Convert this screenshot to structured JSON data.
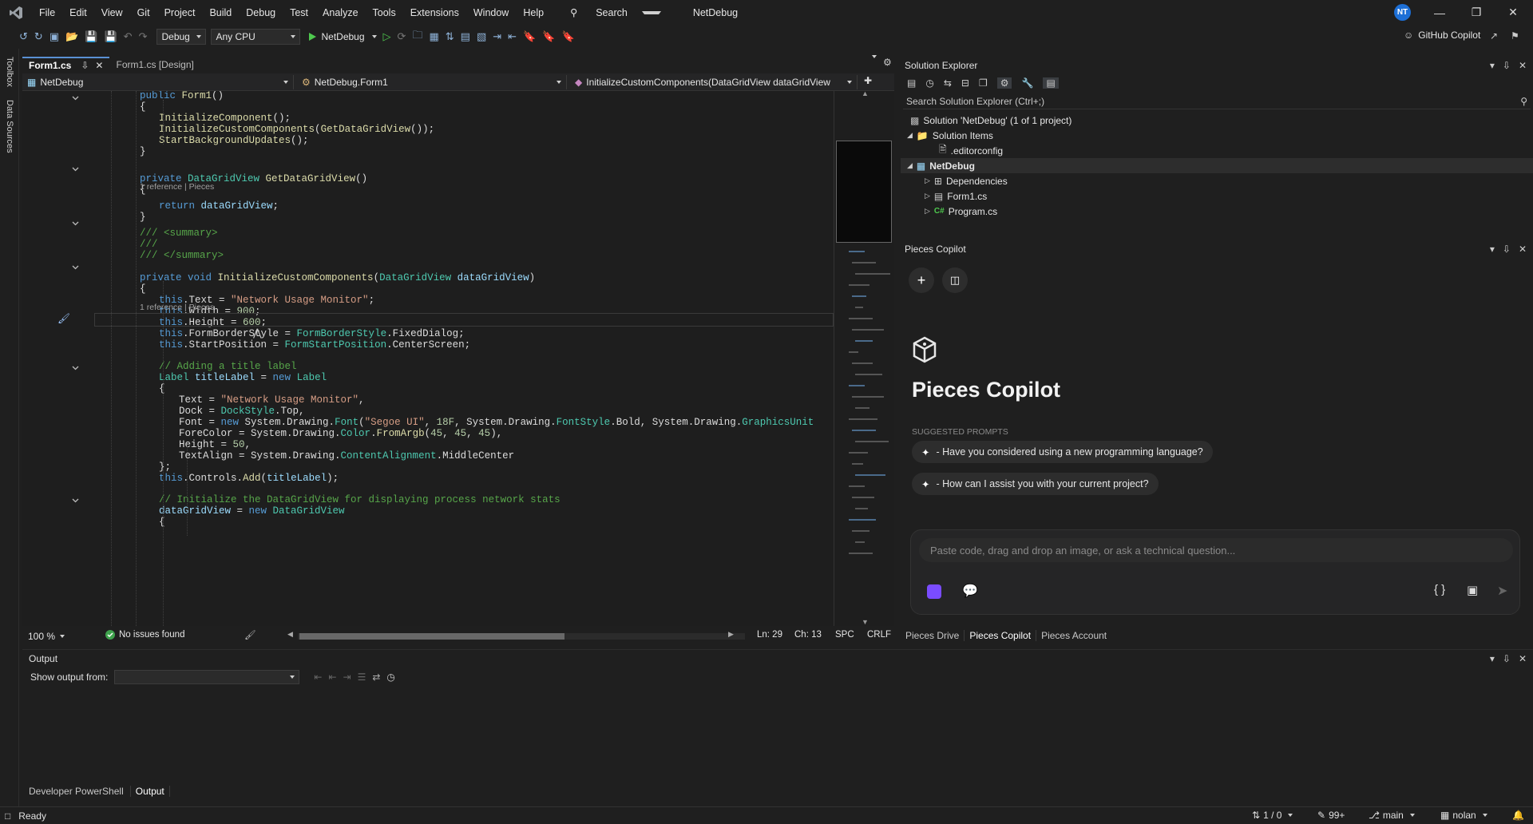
{
  "window": {
    "menu": [
      "File",
      "Edit",
      "View",
      "Git",
      "Project",
      "Build",
      "Debug",
      "Test",
      "Analyze",
      "Tools",
      "Extensions",
      "Window",
      "Help"
    ],
    "search_label": "Search",
    "solution_name": "NetDebug",
    "avatar_initials": "NT"
  },
  "toolbar": {
    "config": "Debug",
    "platform": "Any CPU",
    "run_target": "NetDebug",
    "github_copilot": "GitHub Copilot"
  },
  "left_strip": {
    "toolbox": "Toolbox",
    "data_sources": "Data Sources"
  },
  "editor": {
    "tabs": [
      {
        "label": "Form1.cs",
        "active": true
      },
      {
        "label": "Form1.cs [Design]",
        "active": false
      }
    ],
    "nav": {
      "project": "NetDebug",
      "class": "NetDebug.Form1",
      "member": "InitializeCustomComponents(DataGridView dataGridView"
    },
    "zoom": "100 %",
    "issues": "No issues found",
    "position": {
      "ln": "Ln: 29",
      "ch": "Ch: 13",
      "spc": "SPC",
      "crlf": "CRLF"
    },
    "code_lines": [
      [
        [
          "k",
          "public "
        ],
        [
          "m",
          "Form1"
        ],
        [
          "p",
          "()"
        ]
      ],
      [
        [
          "p",
          "{"
        ]
      ],
      [
        [
          "m",
          "InitializeComponent"
        ],
        [
          "p",
          "();"
        ]
      ],
      [
        [
          "m",
          "InitializeCustomComponents"
        ],
        [
          "p",
          "("
        ],
        [
          "m",
          "GetDataGridView"
        ],
        [
          "p",
          "());"
        ]
      ],
      [
        [
          "m",
          "StartBackgroundUpdates"
        ],
        [
          "p",
          "();"
        ]
      ],
      [
        [
          "p",
          "}"
        ]
      ],
      [],
      [
        [
          "k",
          "private "
        ],
        [
          "t",
          "DataGridView "
        ],
        [
          "m",
          "GetDataGridView"
        ],
        [
          "p",
          "()"
        ]
      ],
      [
        [
          "p",
          "{"
        ]
      ],
      [
        [
          "k",
          "return "
        ],
        [
          "v",
          "dataGridView"
        ],
        [
          "p",
          ";"
        ]
      ],
      [
        [
          "p",
          "}"
        ]
      ],
      [],
      [
        [
          "c",
          "/// <summary>"
        ]
      ],
      [
        [
          "c",
          "///"
        ]
      ],
      [
        [
          "c",
          "/// </summary>"
        ]
      ],
      [
        [
          "k",
          "private void "
        ],
        [
          "m",
          "InitializeCustomComponents"
        ],
        [
          "p",
          "("
        ],
        [
          "t",
          "DataGridView "
        ],
        [
          "v",
          "dataGridView"
        ],
        [
          "p",
          ")"
        ]
      ],
      [
        [
          "p",
          "{"
        ]
      ],
      [
        [
          "k",
          "this"
        ],
        [
          "p",
          ".Text = "
        ],
        [
          "s",
          "\"Network Usage Monitor\""
        ],
        [
          "p",
          ";"
        ]
      ],
      [
        [
          "k",
          "this"
        ],
        [
          "p",
          ".Width = "
        ],
        [
          "n",
          "900"
        ],
        [
          "p",
          ";"
        ]
      ],
      [
        [
          "k",
          "this"
        ],
        [
          "p",
          ".Height = "
        ],
        [
          "n",
          "600"
        ],
        [
          "p",
          ";"
        ]
      ],
      [
        [
          "k",
          "this"
        ],
        [
          "p",
          ".FormBorderStyle = "
        ],
        [
          "t",
          "FormBorderStyle"
        ],
        [
          "p",
          ".FixedDialog;"
        ]
      ],
      [
        [
          "k",
          "this"
        ],
        [
          "p",
          ".StartPosition = "
        ],
        [
          "t",
          "FormStartPosition"
        ],
        [
          "p",
          ".CenterScreen;"
        ]
      ],
      [],
      [
        [
          "c",
          "// Adding a title label"
        ]
      ],
      [
        [
          "t",
          "Label "
        ],
        [
          "v",
          "titleLabel"
        ],
        [
          "p",
          " = "
        ],
        [
          "k",
          "new "
        ],
        [
          "t",
          "Label"
        ]
      ],
      [
        [
          "p",
          "{"
        ]
      ],
      [
        [
          "p",
          "Text = "
        ],
        [
          "s",
          "\"Network Usage Monitor\""
        ],
        [
          "p",
          ","
        ]
      ],
      [
        [
          "p",
          "Dock = "
        ],
        [
          "t",
          "DockStyle"
        ],
        [
          "p",
          ".Top,"
        ]
      ],
      [
        [
          "p",
          "Font = "
        ],
        [
          "k",
          "new "
        ],
        [
          "p",
          "System.Drawing."
        ],
        [
          "t",
          "Font"
        ],
        [
          "p",
          "("
        ],
        [
          "s",
          "\"Segoe UI\""
        ],
        [
          "p",
          ", "
        ],
        [
          "n",
          "18F"
        ],
        [
          "p",
          ", System.Drawing."
        ],
        [
          "t",
          "FontStyle"
        ],
        [
          "p",
          ".Bold, System.Drawing."
        ],
        [
          "t",
          "GraphicsUnit"
        ]
      ],
      [
        [
          "p",
          "ForeColor = System.Drawing."
        ],
        [
          "t",
          "Color"
        ],
        [
          "p",
          "."
        ],
        [
          "m",
          "FromArgb"
        ],
        [
          "p",
          "("
        ],
        [
          "n",
          "45"
        ],
        [
          "p",
          ", "
        ],
        [
          "n",
          "45"
        ],
        [
          "p",
          ", "
        ],
        [
          "n",
          "45"
        ],
        [
          "p",
          "),"
        ]
      ],
      [
        [
          "p",
          "Height = "
        ],
        [
          "n",
          "50"
        ],
        [
          "p",
          ","
        ]
      ],
      [
        [
          "p",
          "TextAlign = System.Drawing."
        ],
        [
          "t",
          "ContentAlignment"
        ],
        [
          "p",
          ".MiddleCenter"
        ]
      ],
      [
        [
          "p",
          "};"
        ]
      ],
      [
        [
          "k",
          "this"
        ],
        [
          "p",
          ".Controls."
        ],
        [
          "m",
          "Add"
        ],
        [
          "p",
          "("
        ],
        [
          "v",
          "titleLabel"
        ],
        [
          "p",
          ");"
        ]
      ],
      [],
      [
        [
          "c",
          "// Initialize the DataGridView for displaying process network stats"
        ]
      ],
      [
        [
          "v",
          "dataGridView"
        ],
        [
          "p",
          " = "
        ],
        [
          "k",
          "new "
        ],
        [
          "t",
          "DataGridView"
        ]
      ],
      [
        [
          "p",
          "{"
        ]
      ]
    ],
    "reference_label": "1 reference | Pieces"
  },
  "solution_explorer": {
    "title": "Solution Explorer",
    "search_placeholder": "Search Solution Explorer (Ctrl+;)",
    "items": [
      {
        "label": "Solution 'NetDebug' (1 of 1 project)"
      },
      {
        "label": "Solution Items"
      },
      {
        "label": ".editorconfig"
      },
      {
        "label": "NetDebug"
      },
      {
        "label": "Dependencies"
      },
      {
        "label": "Form1.cs"
      },
      {
        "label": "Program.cs"
      }
    ]
  },
  "pieces": {
    "pane_title": "Pieces Copilot",
    "heading": "Pieces Copilot",
    "suggested_label": "SUGGESTED PROMPTS",
    "prompts": [
      "- Have you considered using a new programming language?",
      "- How can I assist you with your current project?"
    ],
    "input_placeholder": "Paste code, drag and drop an image, or ask a technical question...",
    "tabs": [
      "Pieces Drive",
      "Pieces Copilot",
      "Pieces Account"
    ]
  },
  "output": {
    "title": "Output",
    "show_from": "Show output from:",
    "bottom_tabs": [
      "Developer PowerShell",
      "Output"
    ]
  },
  "status": {
    "ready": "Ready",
    "lines": "1 / 0",
    "pencil": "99+",
    "branch": "main",
    "user": "nolan"
  }
}
